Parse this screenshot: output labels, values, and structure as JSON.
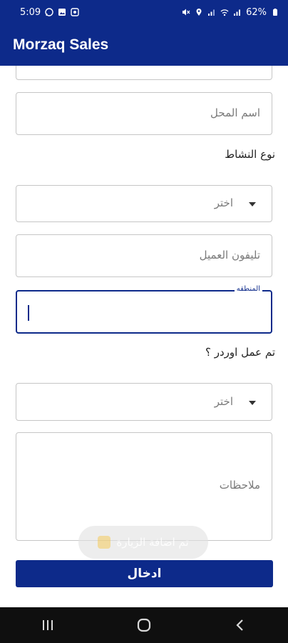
{
  "status_bar": {
    "time": "5:09",
    "battery": "62%",
    "icons_left": [
      "whatsapp-icon",
      "gallery-icon",
      "settings-app-icon"
    ],
    "icons_right": [
      "mute-icon",
      "location-icon",
      "signal-icon",
      "wifi-icon",
      "signal-icon",
      "battery-icon"
    ]
  },
  "app_bar": {
    "title": "Morzaq Sales"
  },
  "form": {
    "shop_name": {
      "placeholder": "اسم المحل"
    },
    "activity_type": {
      "label": "نوع النشاط",
      "selected": "اختر"
    },
    "customer_phone": {
      "placeholder": "تليفون العميل"
    },
    "region": {
      "floating_label": "المنطقه",
      "value": ""
    },
    "order_made": {
      "label": "تم عمل اوردر ؟",
      "selected": "اختر"
    },
    "notes": {
      "placeholder": "ملاحظات"
    },
    "submit_label": "ادخال"
  },
  "toast": {
    "text": "تم اضافة الزيارة"
  },
  "nav_bar": {
    "buttons": [
      "recents-icon",
      "home-icon",
      "back-icon"
    ]
  },
  "colors": {
    "primary": "#0d2a8a",
    "nav_background": "#0f0f0f",
    "field_border": "#c6c6c6"
  }
}
